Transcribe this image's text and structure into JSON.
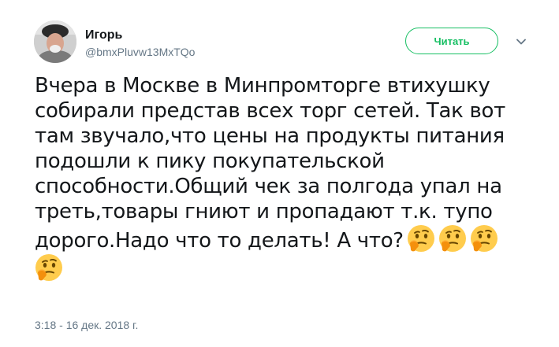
{
  "author": {
    "name": "Игорь",
    "handle": "@bmxPluvw13MxTQo",
    "avatar_icon": "avatar"
  },
  "follow_button": {
    "label": "Читать",
    "color": "#17bf63"
  },
  "menu": {
    "icon": "chevron-down-icon"
  },
  "tweet": {
    "lines": [
      "Вчера в Москве в Минпромторге втихушку",
      "собирали представ всех торг сетей. Так вот",
      "там звучало,что цены на продукты питания",
      "подошли к пику покупательской",
      "способности.Общий чек за полгода упал на",
      "треть,товары гниют и пропадают т.к. тупо",
      "дорого.Надо что то делать! А что?"
    ],
    "emoji": "thinking-face",
    "emoji_count": 4
  },
  "timestamp": "3:18 - 16 дек. 2018 г."
}
